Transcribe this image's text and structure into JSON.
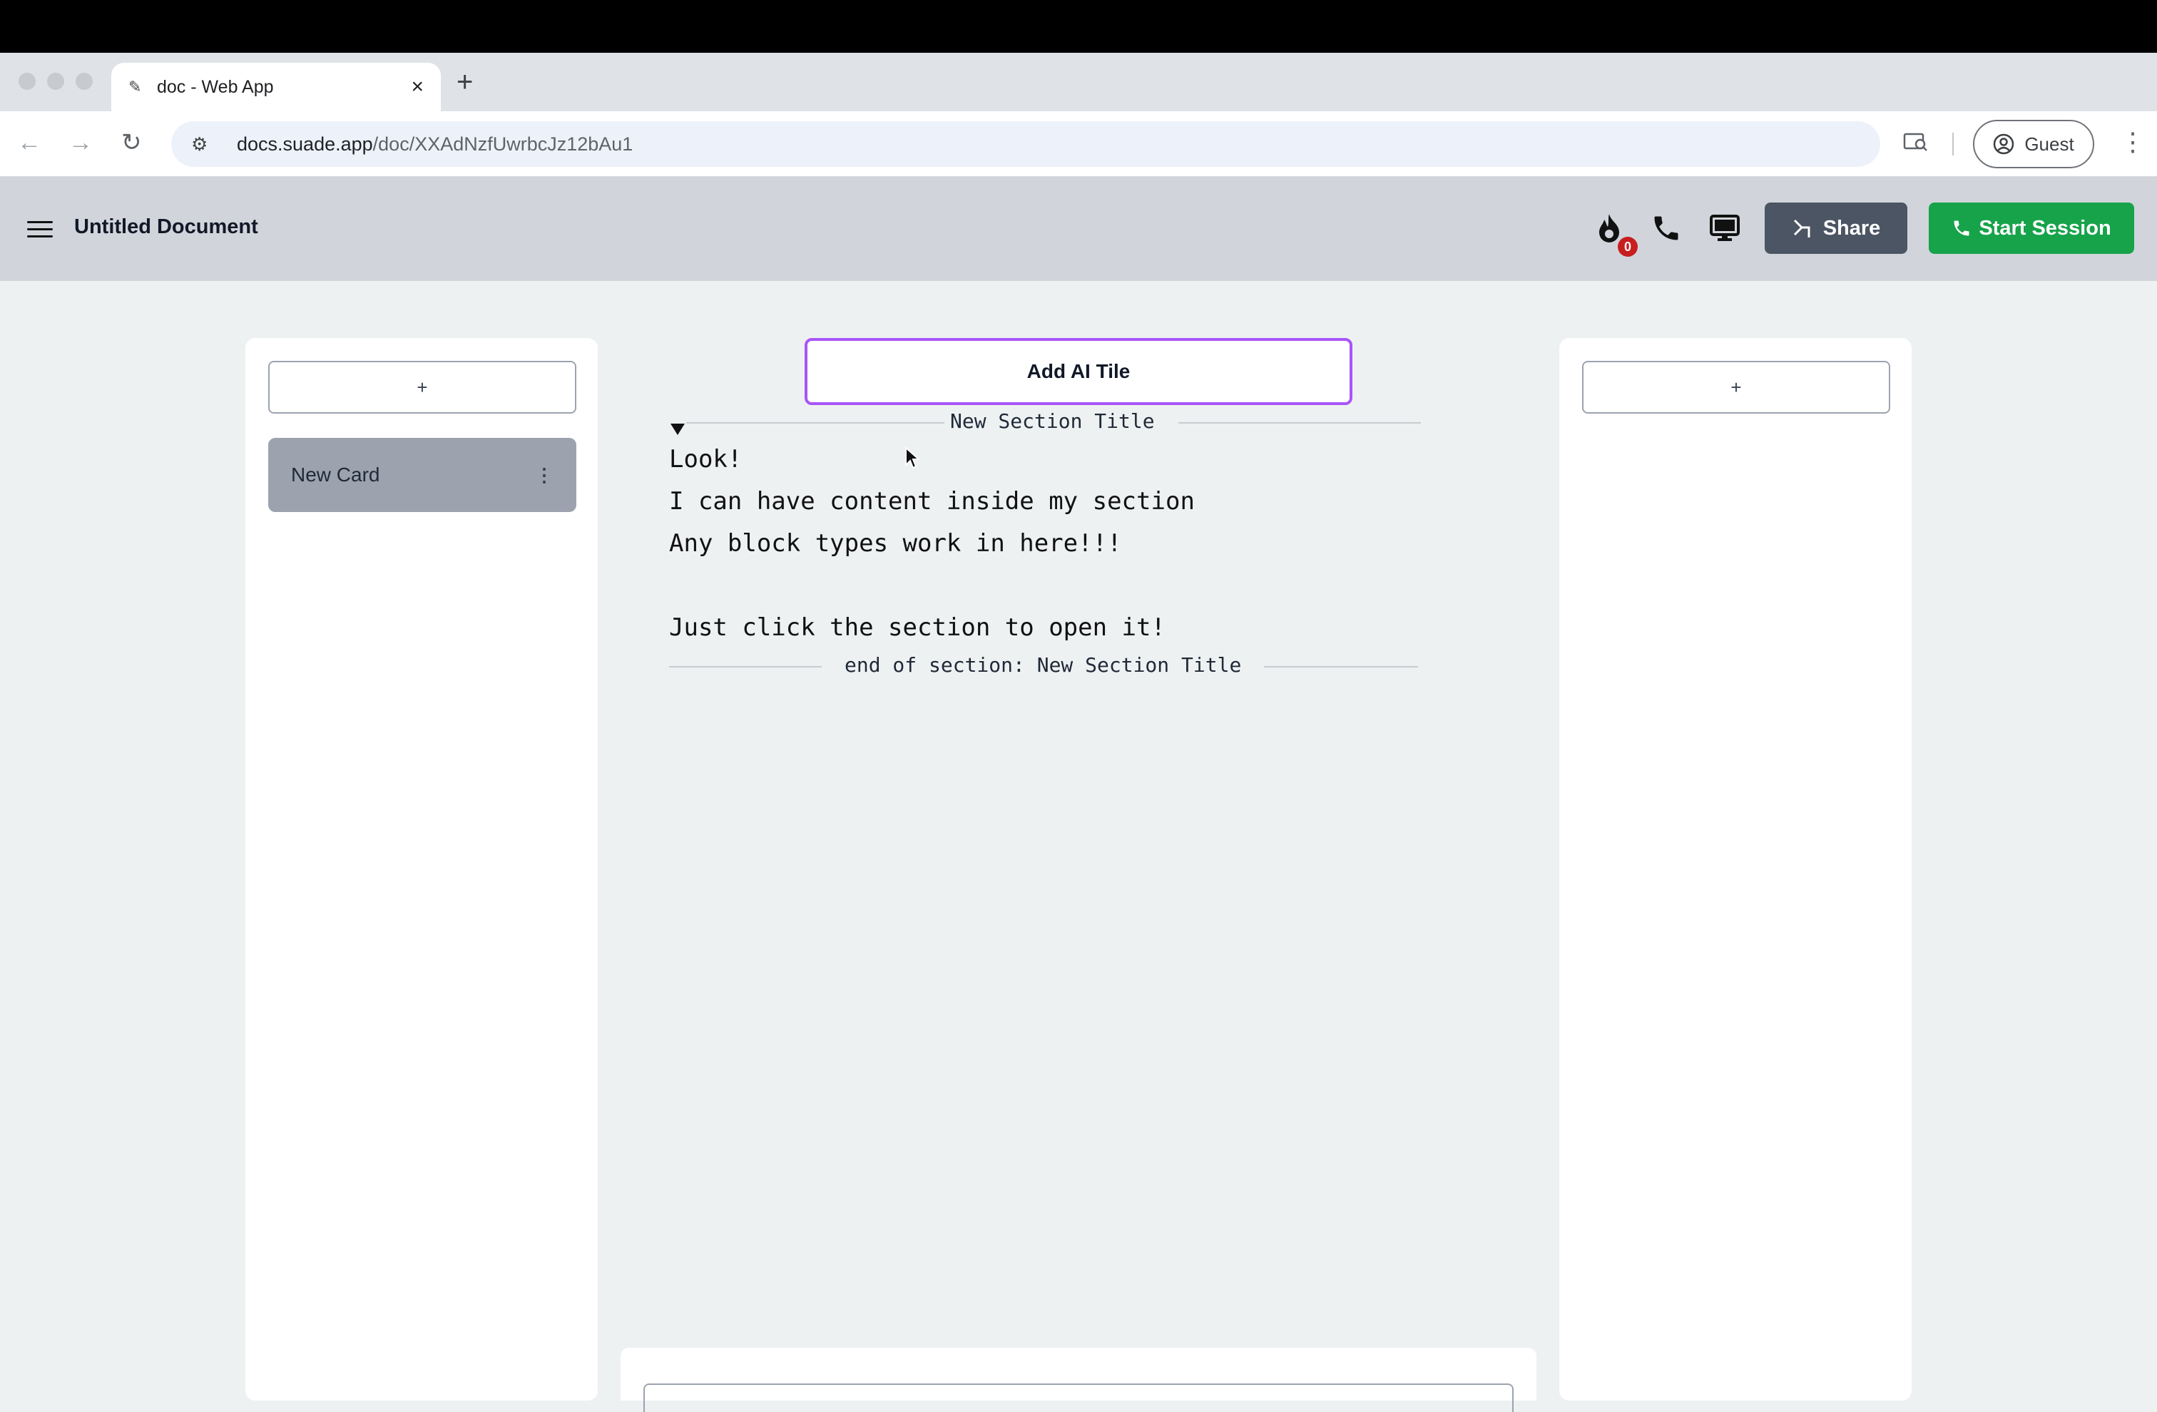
{
  "browser": {
    "tab_title": "doc - Web App",
    "new_tab_label": "+",
    "url_domain": "docs.suade.app",
    "url_path": "/doc/XXAdNzfUwrbcJz12bAu1",
    "profile_label": "Guest"
  },
  "header": {
    "doc_title": "Untitled Document",
    "streak_count": "0",
    "share_label": "Share",
    "start_session_label": "Start Session"
  },
  "left_panel": {
    "add_label": "+",
    "cards": [
      {
        "title": "New Card"
      }
    ]
  },
  "right_panel": {
    "add_label": "+"
  },
  "editor": {
    "ai_tile_label": "Add AI Tile",
    "section_title": "New Section Title",
    "lines": [
      "Look!",
      "I can have content inside my section",
      "Any block types work in here!!!",
      "",
      "Just click the section to open it!"
    ],
    "section_end_label": "end of section: New Section Title"
  },
  "colors": {
    "share_bg": "#4b5563",
    "start_session_bg": "#16a34a",
    "ai_tile_border": "#a855f7",
    "badge_bg": "#c81e1e",
    "header_bg": "#d1d5db"
  }
}
